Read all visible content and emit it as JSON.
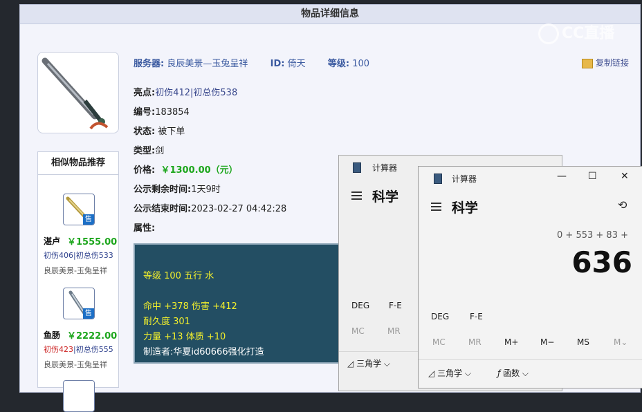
{
  "item_page": {
    "header_title": "物品详细信息",
    "server_label": "服务器:",
    "server_value": "良辰美景—玉兔呈祥",
    "id_label": "ID:",
    "id_value": "倚天",
    "level_label": "等级:",
    "level_value": "100",
    "copy_link": "复制链接",
    "highlight_label": "亮点:",
    "highlight_value": "初伤412|初总伤538",
    "number_label": "编号:",
    "number_value": "183854",
    "status_label": "状态:",
    "status_value": "被下单",
    "type_label": "类型:",
    "type_value": "剑",
    "price_label": "价格:",
    "price_value": "￥1300.00（元）",
    "remaining_label": "公示剩余时间:",
    "remaining_value": "1天9时",
    "end_label": "公示结束时间:",
    "end_value": "2023-02-27 04:42:28",
    "attr_label": "属性:",
    "attributes": {
      "line1": "等级 100 五行 水",
      "line2": "命中 +378 伤害 +412",
      "line3": "耐久度 301",
      "line4": "力量 +13 体质 +10",
      "line5": "制造者:华夏id60666强化打造"
    },
    "similar_title": "相似物品推荐",
    "similar": [
      {
        "name": "湛卢",
        "price": "￥1555.00",
        "stat_a": "初伤406",
        "stat_b": "|初总伤533",
        "server": "良辰美景-玉兔呈祥",
        "badge": "售"
      },
      {
        "name": "鱼肠",
        "price": "￥2222.00",
        "stat_a": "初伤423",
        "stat_b": "|初总伤555",
        "server": "良辰美景-玉兔呈祥",
        "badge": "售"
      }
    ]
  },
  "watermark": "CC直播",
  "calc_back": {
    "title": "计算器",
    "mode": "科学",
    "deg": "DEG",
    "fe": "F-E",
    "mc": "MC",
    "mr": "MR",
    "trig": "三角学"
  },
  "calc_front": {
    "title": "计算器",
    "mode": "科学",
    "expression": "0 + 553 + 83 +",
    "result": "636",
    "deg": "DEG",
    "fe": "F-E",
    "mc": "MC",
    "mr": "MR",
    "mplus": "M+",
    "mminus": "M−",
    "ms": "MS",
    "mv": "M",
    "trig": "三角学",
    "func": "函数",
    "minimize": "—",
    "maximize": "☐",
    "close": "✕",
    "history": "⟲"
  },
  "colors": {
    "price_green": "#1da61d",
    "attr_bg": "#234e63",
    "attr_yellow": "#f2ef2c"
  }
}
